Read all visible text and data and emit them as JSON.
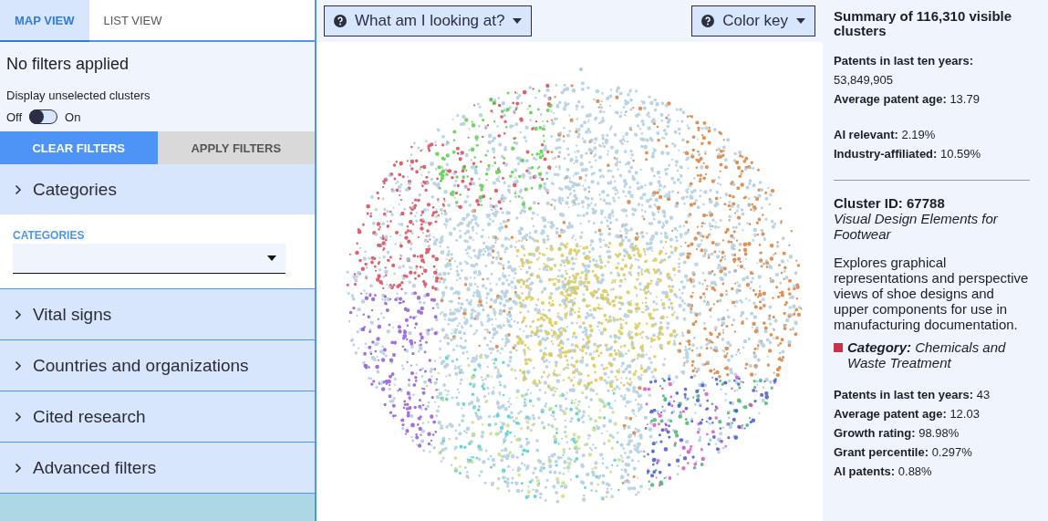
{
  "tabs": [
    {
      "label": "MAP VIEW",
      "selected": true
    },
    {
      "label": "LIST VIEW",
      "selected": false
    }
  ],
  "filter_status": "No filters applied",
  "toggle": {
    "label": "Display unselected clusters",
    "off_label": "Off",
    "on_label": "On",
    "on": false
  },
  "filter_buttons": [
    {
      "label": "CLEAR FILTERS",
      "kind": "primary"
    },
    {
      "label": "APPLY FILTERS",
      "kind": "secondary"
    }
  ],
  "sections": [
    {
      "title": "Categories",
      "expanded": true,
      "field_label": "CATEGORIES"
    },
    {
      "title": "Vital signs",
      "expanded": false
    },
    {
      "title": "Countries and organizations",
      "expanded": false
    },
    {
      "title": "Cited research",
      "expanded": false
    },
    {
      "title": "Advanced filters",
      "expanded": false
    }
  ],
  "map_buttons": [
    {
      "label": "What am I looking at?"
    },
    {
      "label": "Color key"
    }
  ],
  "summary": {
    "title": "Summary of 116,310 visible clusters",
    "stat_groups": [
      [
        "**Patents in last ten years:** 53,849,905",
        "**Average patent age:** 13.79"
      ],
      [
        "**AI relevant:** 2.19%",
        "**Industry-affiliated:** 10.59%"
      ]
    ]
  },
  "cluster": {
    "id": "Cluster ID: 67788",
    "name": "Visual Design Elements for Footwear",
    "description": "Explores graphical representations and perspective views of shoe designs and upper components for use in manufacturing documentation.",
    "category": {
      "text": "**Category:** Chemicals and Waste Treatment",
      "color": "#c8324a"
    },
    "stats": [
      "**Patents in last ten years:** 43",
      "**Average patent age:** 12.03",
      "**Growth rating:** 98.98%",
      "**Grant percentile:** 0.297%",
      "**AI patents:** 0.88%"
    ]
  }
}
